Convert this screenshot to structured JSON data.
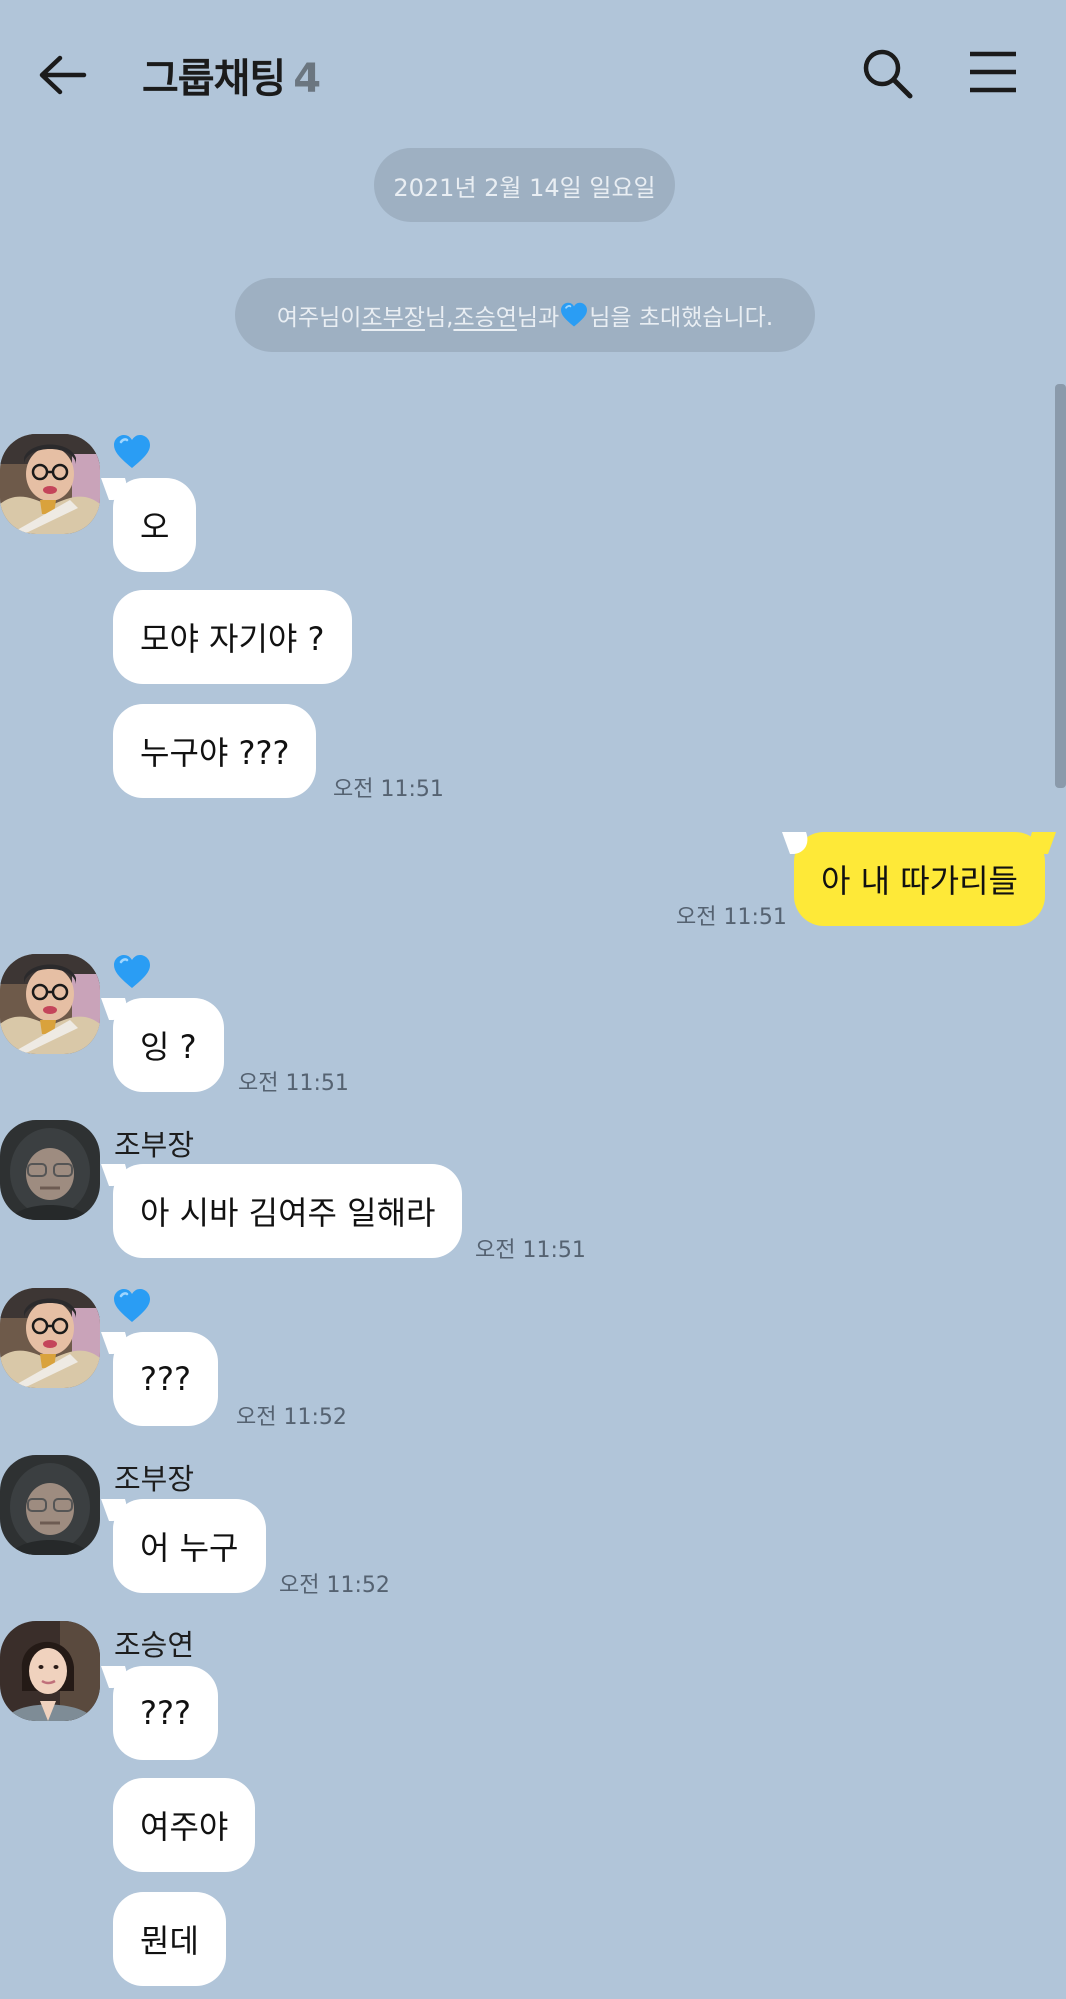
{
  "header": {
    "title": "그룹채팅",
    "member_count": "4"
  },
  "date_divider": "2021년 2월 14일 일요일",
  "notice": {
    "inviter": "여주님이 ",
    "name1": "조부장",
    "sep1": "님, ",
    "name2": "조승연",
    "sep2": "님과 ",
    "sep3": "님을 초대했습니다."
  },
  "messages": [
    {
      "sender": "heart",
      "text": "오"
    },
    {
      "sender": "heart",
      "text": "모야 자기야 ?"
    },
    {
      "sender": "heart",
      "text": "누구야 ???",
      "time": "오전 11:51"
    },
    {
      "sender": "me",
      "text": "아 내 따가리들",
      "time": "오전 11:51"
    },
    {
      "sender": "heart",
      "text": "잉 ?",
      "time": "오전 11:51"
    },
    {
      "sender": "조부장",
      "text": "아 시바 김여주 일해라",
      "time": "오전 11:51"
    },
    {
      "sender": "heart",
      "text": "???",
      "time": "오전 11:52"
    },
    {
      "sender": "조부장",
      "text": "어 누구",
      "time": "오전 11:52"
    },
    {
      "sender": "조승연",
      "text": "???"
    },
    {
      "sender": "조승연",
      "text": "여주야"
    },
    {
      "sender": "조승연",
      "text": "뭔데"
    }
  ],
  "colors": {
    "background": "#b1c5d9",
    "my_bubble": "#fee938",
    "other_bubble": "#ffffff",
    "heart": "#2a9df4"
  },
  "icons": [
    "back-arrow-icon",
    "search-icon",
    "menu-icon",
    "heart-icon"
  ]
}
